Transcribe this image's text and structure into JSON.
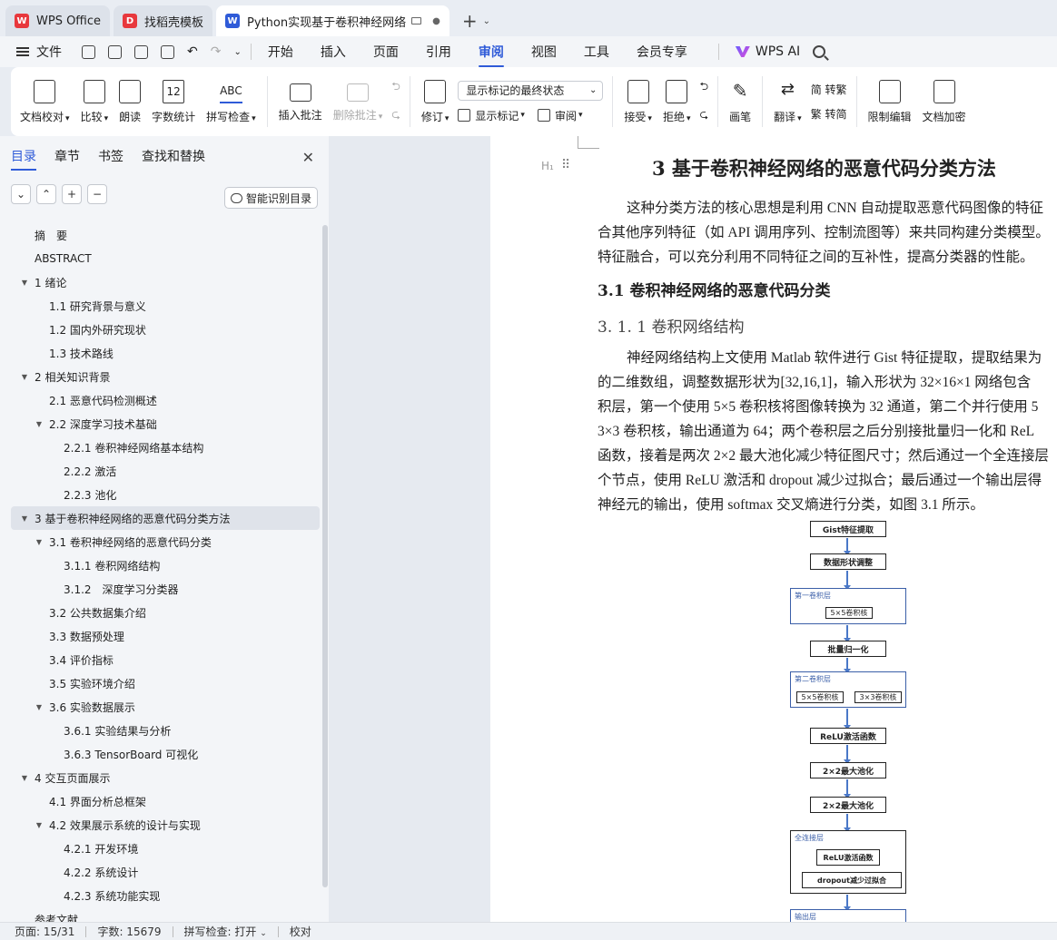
{
  "tabs": [
    {
      "label": "WPS Office",
      "state": "inactive"
    },
    {
      "label": "找稻壳模板",
      "state": "inactive"
    },
    {
      "label": "Python实现基于卷积神经网络",
      "state": "active"
    }
  ],
  "menu": {
    "file": "文件",
    "items": [
      "开始",
      "插入",
      "页面",
      "引用",
      "审阅",
      "视图",
      "工具",
      "会员专享"
    ],
    "active": "审阅",
    "ai": "WPS AI"
  },
  "ribbon": {
    "check": "文档校对",
    "compare": "比较",
    "read": "朗读",
    "wordcount": "字数统计",
    "spell": "拼写检查",
    "spell_icon_text": "ABC",
    "count_icon_text": "12",
    "insert_comment": "插入批注",
    "delete_comment": "删除批注",
    "revise": "修订",
    "markup_select": "显示标记的最终状态",
    "show_markup": "显示标记",
    "review": "审阅",
    "accept": "接受",
    "reject": "拒绝",
    "pen": "画笔",
    "translate": "翻译",
    "to_trad": "简 转繁",
    "to_simp": "繁 转简",
    "restrict": "限制编辑",
    "encrypt": "文档加密"
  },
  "sidebar": {
    "tabs": [
      "目录",
      "章节",
      "书签",
      "查找和替换"
    ],
    "active_tab": "目录",
    "smart_button": "智能识别目录",
    "toc": [
      {
        "level": 1,
        "text": "摘　要",
        "toggle": ""
      },
      {
        "level": 1,
        "text": "ABSTRACT",
        "toggle": ""
      },
      {
        "level": 1,
        "text": "1 绪论",
        "toggle": "▼"
      },
      {
        "level": 2,
        "text": "1.1 研究背景与意义",
        "toggle": ""
      },
      {
        "level": 2,
        "text": "1.2 国内外研究现状",
        "toggle": ""
      },
      {
        "level": 2,
        "text": "1.3 技术路线",
        "toggle": ""
      },
      {
        "level": 1,
        "text": "2 相关知识背景",
        "toggle": "▼"
      },
      {
        "level": 2,
        "text": "2.1 恶意代码检测概述",
        "toggle": ""
      },
      {
        "level": 2,
        "text": "2.2 深度学习技术基础",
        "toggle": "▼"
      },
      {
        "level": 3,
        "text": "2.2.1 卷积神经网络基本结构",
        "toggle": ""
      },
      {
        "level": 3,
        "text": "2.2.2 激活",
        "toggle": ""
      },
      {
        "level": 3,
        "text": "2.2.3 池化",
        "toggle": ""
      },
      {
        "level": 1,
        "text": "3 基于卷积神经网络的恶意代码分类方法",
        "toggle": "▼",
        "selected": true
      },
      {
        "level": 2,
        "text": "3.1 卷积神经网络的恶意代码分类",
        "toggle": "▼"
      },
      {
        "level": 3,
        "text": "3.1.1 卷积网络结构",
        "toggle": ""
      },
      {
        "level": 3,
        "text": "3.1.2　深度学习分类器",
        "toggle": ""
      },
      {
        "level": 2,
        "text": "3.2 公共数据集介绍",
        "toggle": ""
      },
      {
        "level": 2,
        "text": "3.3 数据预处理",
        "toggle": ""
      },
      {
        "level": 2,
        "text": "3.4 评价指标",
        "toggle": ""
      },
      {
        "level": 2,
        "text": "3.5 实验环境介绍",
        "toggle": ""
      },
      {
        "level": 2,
        "text": "3.6 实验数据展示",
        "toggle": "▼"
      },
      {
        "level": 3,
        "text": "3.6.1 实验结果与分析",
        "toggle": ""
      },
      {
        "level": 3,
        "text": "3.6.3 TensorBoard 可视化",
        "toggle": ""
      },
      {
        "level": 1,
        "text": "4 交互页面展示",
        "toggle": "▼"
      },
      {
        "level": 2,
        "text": "4.1 界面分析总框架",
        "toggle": ""
      },
      {
        "level": 2,
        "text": "4.2 效果展示系统的设计与实现",
        "toggle": "▼"
      },
      {
        "level": 3,
        "text": "4.2.1 开发环境",
        "toggle": ""
      },
      {
        "level": 3,
        "text": "4.2.2 系统设计",
        "toggle": ""
      },
      {
        "level": 3,
        "text": "4.2.3 系统功能实现",
        "toggle": ""
      },
      {
        "level": 1,
        "text": "参考文献",
        "toggle": ""
      }
    ]
  },
  "document": {
    "h_marker": "H₁",
    "heading1": "3  基于卷积神经网络的恶意代码分类方法",
    "para1": [
      "这种分类方法的核心思想是利用 CNN 自动提取恶意代码图像的特征",
      "合其他序列特征（如 API 调用序列、控制流图等）来共同构建分类模型。",
      "特征融合，可以充分利用不同特征之间的互补性，提高分类器的性能。"
    ],
    "heading2": "3.1  卷积神经网络的恶意代码分类",
    "heading3": "3. 1. 1 卷积网络结构",
    "para2": [
      "神经网络结构上文使用 Matlab 软件进行 Gist 特征提取，提取结果为",
      "的二维数组，调整数据形状为[32,16,1]，输入形状为 32×16×1 网络包含",
      "积层，第一个使用 5×5 卷积核将图像转换为 32 通道，第二个并行使用 5",
      "3×3 卷积核，输出通道为 64；两个卷积层之后分别接批量归一化和 ReL",
      "函数，接着是两次 2×2 最大池化减少特征图尺寸；然后通过一个全连接层",
      "个节点，使用 ReLU 激活和 dropout 减少过拟合；最后通过一个输出层得",
      "神经元的输出，使用 softmax 交叉熵进行分类，如图 3.1 所示。"
    ],
    "flow": {
      "gist": "Gist特征提取",
      "reshape": "数据形状调整",
      "conv1_label": "第一卷积层",
      "conv1_k": "5×5卷积核",
      "bn": "批量归一化",
      "conv2_label": "第二卷积层",
      "conv2_k1": "5×5卷积核",
      "conv2_k2": "3×3卷积核",
      "relu": "ReLU激活函数",
      "pool1": "2×2最大池化",
      "pool2": "2×2最大池化",
      "fc_label": "全连接层",
      "fc_relu": "ReLU激活函数",
      "fc_dropout": "dropout减少过拟合",
      "out_label": "输出层"
    }
  },
  "status": {
    "page": "页面: 15/31",
    "words": "字数: 15679",
    "spell": "拼写检查: 打开",
    "proof": "校对"
  }
}
